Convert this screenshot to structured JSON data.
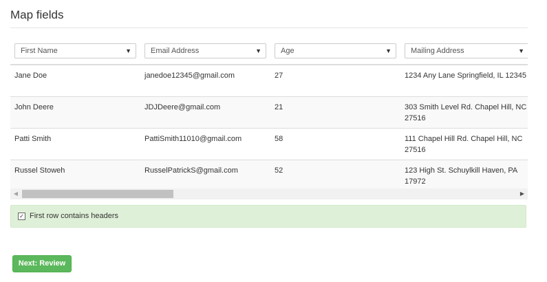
{
  "page": {
    "title": "Map fields"
  },
  "columns": [
    {
      "label": "First Name",
      "icon": "caret-down-icon"
    },
    {
      "label": "Email Address",
      "icon": "caret-down-icon"
    },
    {
      "label": "Age",
      "icon": "caret-down-icon"
    },
    {
      "label": "Mailing Address",
      "icon": "caret-down-icon"
    }
  ],
  "rows": [
    {
      "cells": [
        "Jane Doe",
        "janedoe12345@gmail.com",
        "27",
        "1234 Any Lane Springfield, IL 12345"
      ]
    },
    {
      "cells": [
        "John Deere",
        "JDJDeere@gmail.com",
        "21",
        "303 Smith Level Rd. Chapel Hill, NC 27516"
      ]
    },
    {
      "cells": [
        "Patti Smith",
        "PattiSmith11010@gmail.com",
        "58",
        "111 Chapel Hill Rd. Chapel Hill, NC 27516"
      ]
    },
    {
      "cells": [
        "Russel Stoweh",
        "RusselPatrickS@gmail.com",
        "52",
        "123 High St. Schuylkill Haven, PA 17972"
      ]
    }
  ],
  "header_option": {
    "label": "First row contains headers",
    "checked": true
  },
  "actions": {
    "next_label": "Next: Review"
  },
  "colors": {
    "success_bg": "#dff0d8",
    "button_green": "#5cb85c"
  }
}
